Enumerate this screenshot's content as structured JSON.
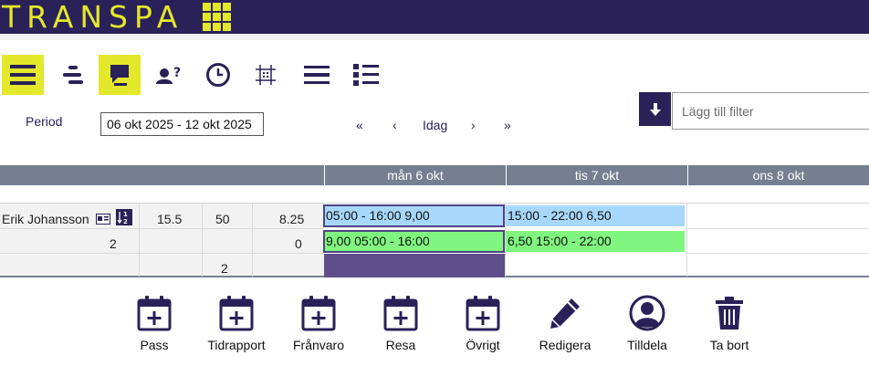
{
  "app": {
    "logo_text": "TRANSPA"
  },
  "toolbar": {
    "buttons": [
      {
        "name": "list-view",
        "active": true
      },
      {
        "name": "timeline-view",
        "active": false
      },
      {
        "name": "comments-view",
        "active": true
      },
      {
        "name": "unassigned-view",
        "active": false
      },
      {
        "name": "time-view",
        "active": false
      },
      {
        "name": "grid-view",
        "active": false
      },
      {
        "name": "rows-view",
        "active": false
      },
      {
        "name": "detail-list-view",
        "active": false
      }
    ]
  },
  "period": {
    "label": "Period",
    "value": "06 okt 2025 - 12 okt 2025"
  },
  "nav": {
    "first": "«",
    "prev": "‹",
    "today": "Idag",
    "next": "›",
    "last": "»"
  },
  "filter": {
    "placeholder": "Lägg till filter"
  },
  "days": [
    {
      "label": "mån 6 okt"
    },
    {
      "label": "tis 7 okt"
    },
    {
      "label": "ons 8 okt"
    }
  ],
  "employee": {
    "name": "Erik Johansson",
    "row1": {
      "c1": "15.5",
      "c2": "50",
      "c3": "8.25"
    },
    "row2": {
      "c0": "2",
      "c3": "0"
    },
    "row3": {
      "c2": "2"
    }
  },
  "shifts": {
    "mon_row1": "05:00 - 16:00 9,00",
    "mon_row2": "9,00 05:00 - 16:00",
    "tue_row1": "15:00 - 22:00 6,50",
    "tue_row2": "6,50 15:00 - 22:00"
  },
  "actions": [
    {
      "label": "Pass",
      "icon": "calendar-plus-icon"
    },
    {
      "label": "Tidrapport",
      "icon": "calendar-plus-icon"
    },
    {
      "label": "Frånvaro",
      "icon": "calendar-plus-icon"
    },
    {
      "label": "Resa",
      "icon": "calendar-plus-icon"
    },
    {
      "label": "Övrigt",
      "icon": "calendar-plus-icon"
    },
    {
      "label": "Redigera",
      "icon": "pencil-icon"
    },
    {
      "label": "Tilldela",
      "icon": "user-circle-icon"
    },
    {
      "label": "Ta bort",
      "icon": "trash-icon"
    }
  ],
  "colors": {
    "brand": "#2a2159",
    "accent": "#e3e82a",
    "header_gray": "#757f91",
    "shift_blue": "#a7d8fb",
    "shift_green": "#80f57f",
    "selected_cell": "#5e4f8a"
  }
}
